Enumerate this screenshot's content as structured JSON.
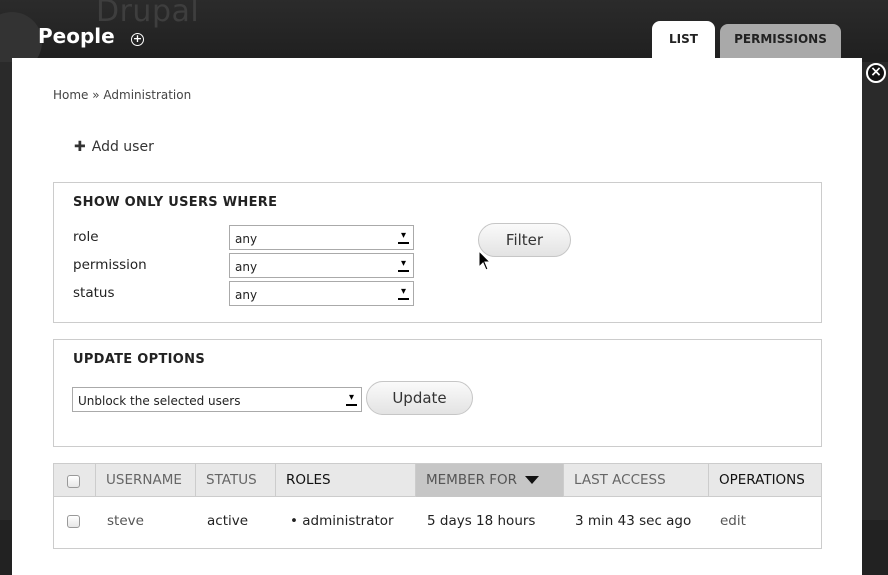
{
  "background": {
    "brand": "Drupal"
  },
  "overlay": {
    "title": "People",
    "tabs": [
      {
        "label": "LIST",
        "active": true
      },
      {
        "label": "PERMISSIONS",
        "active": false
      }
    ]
  },
  "breadcrumb": "Home » Administration",
  "actions": {
    "add_user_label": "Add user"
  },
  "filter": {
    "legend": "SHOW ONLY USERS WHERE",
    "fields": [
      {
        "label": "role",
        "value": "any"
      },
      {
        "label": "permission",
        "value": "any"
      },
      {
        "label": "status",
        "value": "any"
      }
    ],
    "button_label": "Filter"
  },
  "update": {
    "legend": "UPDATE OPTIONS",
    "selected_action": "Unblock the selected users",
    "button_label": "Update"
  },
  "table": {
    "columns": [
      "USERNAME",
      "STATUS",
      "ROLES",
      "MEMBER FOR",
      "LAST ACCESS",
      "OPERATIONS"
    ],
    "sorted_column": "MEMBER FOR",
    "rows": [
      {
        "username": "steve",
        "status": "active",
        "roles": "administrator",
        "member_for": "5 days 18 hours",
        "last_access": "3 min 43 sec ago",
        "operation": "edit"
      }
    ]
  },
  "colors": {
    "tab_active_bg": "#ffffff",
    "tab_inactive_bg": "#a9a9a9",
    "sorted_header_bg": "#c6c6c6",
    "header_bg": "#e8e8e8"
  }
}
